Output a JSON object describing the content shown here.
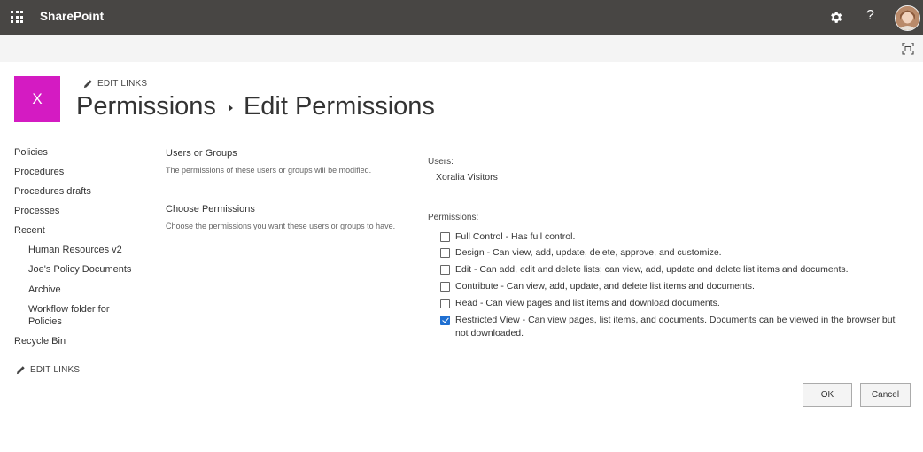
{
  "suite": {
    "brand": "SharePoint",
    "icons": [
      "waffle-icon",
      "gear-icon",
      "help-icon",
      "avatar"
    ],
    "help_glyph": "?"
  },
  "header": {
    "logo_letter": "X",
    "logo_color": "#d41bc2",
    "edit_links": "EDIT LINKS",
    "breadcrumb": [
      "Permissions",
      "Edit Permissions"
    ]
  },
  "leftnav": {
    "items": [
      "Policies",
      "Procedures",
      "Procedures drafts",
      "Processes",
      "Recent"
    ],
    "recent": [
      "Human Resources v2",
      "Joe's Policy Documents",
      "Archive",
      "Workflow folder for Policies"
    ],
    "recycle_bin": "Recycle Bin",
    "edit_links": "EDIT LINKS"
  },
  "sections": {
    "users_or_groups": {
      "title": "Users or Groups",
      "description": "The permissions of these users or groups will be modified."
    },
    "choose_permissions": {
      "title": "Choose Permissions",
      "description": "Choose the permissions you want these users or groups to have."
    }
  },
  "form": {
    "users_label": "Users:",
    "users_value": "Xoralia Visitors",
    "permissions_label": "Permissions:",
    "permissions": [
      {
        "text": "Full Control - Has full control.",
        "checked": false
      },
      {
        "text": "Design - Can view, add, update, delete, approve, and customize.",
        "checked": false
      },
      {
        "text": "Edit - Can add, edit and delete lists; can view, add, update and delete list items and documents.",
        "checked": false
      },
      {
        "text": "Contribute - Can view, add, update, and delete list items and documents.",
        "checked": false
      },
      {
        "text": "Read - Can view pages and list items and download documents.",
        "checked": false
      },
      {
        "text": "Restricted View - Can view pages, list items, and documents. Documents can be viewed in the browser but not downloaded.",
        "checked": true
      }
    ]
  },
  "buttons": {
    "ok": "OK",
    "cancel": "Cancel"
  },
  "colors": {
    "suitebar": "#484644",
    "accent": "#1f6fd1"
  }
}
